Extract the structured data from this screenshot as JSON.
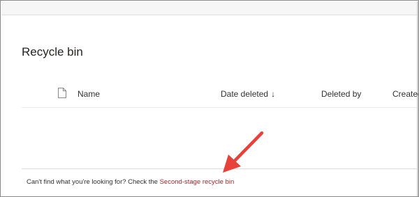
{
  "page": {
    "title": "Recycle bin"
  },
  "columns": {
    "name": "Name",
    "date_deleted": "Date deleted",
    "date_deleted_sort_glyph": "↓",
    "deleted_by": "Deleted by",
    "created": "Created"
  },
  "footer": {
    "prompt": "Can't find what you're looking for? Check the ",
    "link_text": "Second-stage recycle bin"
  },
  "icons": {
    "file_type": "document-icon",
    "sort": "sort-descending-icon",
    "annotation": "red-arrow-icon"
  },
  "colors": {
    "link": "#a4262c",
    "annotation_arrow": "#e8403a"
  }
}
